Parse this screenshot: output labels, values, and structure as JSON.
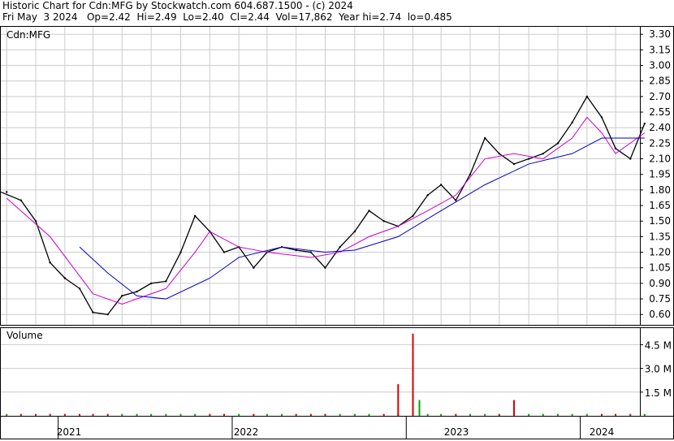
{
  "header": {
    "line1": "Historic Chart for Cdn:MFG by Stockwatch.com 604.687.1500 - (c) 2024",
    "line2": "Fri May  3 2024   Op=2.42  Hi=2.49  Lo=2.40  Cl=2.44  Vol=17,862  Year hi=2.74  lo=0.485"
  },
  "price_panel": {
    "label": "Cdn:MFG",
    "y_ticks": [
      "3.30",
      "3.15",
      "3.00",
      "2.85",
      "2.70",
      "2.55",
      "2.40",
      "2.25",
      "2.10",
      "1.95",
      "1.80",
      "1.65",
      "1.50",
      "1.35",
      "1.20",
      "1.05",
      "0.90",
      "0.75",
      "0.60"
    ]
  },
  "volume_panel": {
    "label": "Volume",
    "y_ticks": [
      "4.5 M",
      "3.0 M",
      "1.5 M"
    ]
  },
  "x_axis": {
    "years": [
      "2021",
      "2022",
      "2023",
      "2024"
    ]
  },
  "colors": {
    "price": "#000000",
    "ma_short": "#cc00cc",
    "ma_long": "#0000cc",
    "volume_up": "#00aa00",
    "volume_down": "#dd0000",
    "grid": "#cccccc"
  },
  "chart_data": {
    "type": "line",
    "title": "Historic Chart for Cdn:MFG by Stockwatch.com 604.687.1500 - (c) 2024",
    "ylim": [
      0.5,
      3.38
    ],
    "ytick_step": 0.15,
    "price_series": {
      "dates": [
        "2020-09",
        "2020-10",
        "2020-11",
        "2020-12",
        "2021-01",
        "2021-02",
        "2021-03",
        "2021-04",
        "2021-05",
        "2021-06",
        "2021-07",
        "2021-08",
        "2021-09",
        "2021-10",
        "2021-11",
        "2021-12",
        "2022-01",
        "2022-02",
        "2022-03",
        "2022-04",
        "2022-05",
        "2022-06",
        "2022-07",
        "2022-08",
        "2022-09",
        "2022-10",
        "2022-11",
        "2022-12",
        "2023-01",
        "2023-02",
        "2023-03",
        "2023-04",
        "2023-05",
        "2023-06",
        "2023-07",
        "2023-08",
        "2023-09",
        "2023-10",
        "2023-11",
        "2023-12",
        "2024-01",
        "2024-02",
        "2024-03",
        "2024-04",
        "2024-05"
      ],
      "close": [
        1.78,
        1.7,
        1.5,
        1.1,
        0.95,
        0.85,
        0.62,
        0.6,
        0.78,
        0.82,
        0.9,
        0.92,
        1.2,
        1.55,
        1.4,
        1.2,
        1.25,
        1.05,
        1.2,
        1.25,
        1.22,
        1.2,
        1.05,
        1.25,
        1.4,
        1.6,
        1.5,
        1.45,
        1.55,
        1.75,
        1.85,
        1.7,
        1.95,
        2.3,
        2.15,
        2.05,
        2.1,
        2.15,
        2.25,
        2.45,
        2.7,
        2.5,
        2.2,
        2.1,
        2.44
      ]
    },
    "ma_short": {
      "dates": [
        "2020-09",
        "2020-12",
        "2021-03",
        "2021-05",
        "2021-08",
        "2021-10",
        "2021-11",
        "2022-01",
        "2022-03",
        "2022-06",
        "2022-08",
        "2022-10",
        "2022-12",
        "2023-02",
        "2023-04",
        "2023-06",
        "2023-08",
        "2023-10",
        "2023-12",
        "2024-01",
        "2024-02",
        "2024-03",
        "2024-05"
      ],
      "values": [
        1.72,
        1.35,
        0.8,
        0.7,
        0.85,
        1.2,
        1.4,
        1.25,
        1.2,
        1.15,
        1.2,
        1.35,
        1.45,
        1.6,
        1.75,
        2.1,
        2.15,
        2.1,
        2.3,
        2.5,
        2.35,
        2.15,
        2.35
      ]
    },
    "ma_long": {
      "dates": [
        "2021-02",
        "2021-04",
        "2021-06",
        "2021-08",
        "2021-11",
        "2022-01",
        "2022-04",
        "2022-07",
        "2022-09",
        "2022-12",
        "2023-03",
        "2023-06",
        "2023-09",
        "2023-12",
        "2024-02",
        "2024-05"
      ],
      "values": [
        1.25,
        1.0,
        0.78,
        0.75,
        0.95,
        1.15,
        1.25,
        1.2,
        1.22,
        1.35,
        1.6,
        1.85,
        2.05,
        2.15,
        2.3,
        2.3
      ]
    },
    "volume_spikes_millions": {
      "dates": [
        "2022-12",
        "2023-01",
        "2023-01",
        "2023-08"
      ],
      "values": [
        2.0,
        5.2,
        1.0,
        1.0
      ]
    }
  }
}
